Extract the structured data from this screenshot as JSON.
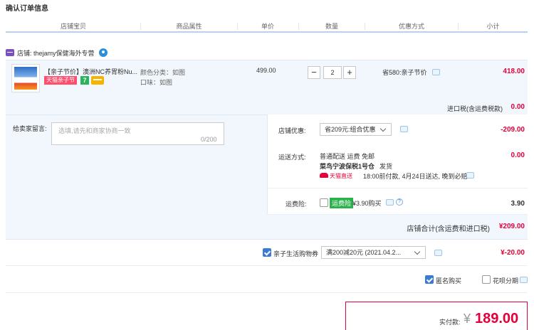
{
  "page_title": "确认订单信息",
  "columns": [
    "店铺宝贝",
    "商品属性",
    "单价",
    "数量",
    "优惠方式",
    "小计"
  ],
  "shop": {
    "label": "店铺: thejamy保健海外专营"
  },
  "item": {
    "title": "【亲子节价】澳洲NC养胃粉Nu...",
    "badge_tmall": "天猫亲子节",
    "badge_seven": "7",
    "attr_color": "颜色分类：如图",
    "attr_taste": "口味：如图",
    "price": "499.00",
    "qty_minus": "−",
    "qty_value": "2",
    "qty_plus": "+",
    "promo": "省580:亲子节价",
    "subtotal": "418.00"
  },
  "import_tax": {
    "label": "进口税(含运费税款)",
    "value": "0.00"
  },
  "note": {
    "label": "给卖家留言:",
    "placeholder": "选填,请先和商家协商一致",
    "count": "0/200"
  },
  "shop_discount": {
    "label": "店铺优惠:",
    "select": "省209元:组合优惠",
    "value": "-209.00"
  },
  "shipping": {
    "label": "运送方式:",
    "line1": "普通配送 运费 免邮",
    "line2_a": "菜鸟宁波保税1号仓",
    "line2_b": "发货",
    "direct_tag": "天猫直送",
    "line3": "18:00前付款, 4月24日送达, 晚到必赔",
    "value": "0.00"
  },
  "insurance": {
    "label": "运费险:",
    "tag": "运费险",
    "text": "¥3.90购买",
    "value": "3.90"
  },
  "shop_total": {
    "label": "店铺合计(含运费和进口税)",
    "value": "¥209.00"
  },
  "coupon": {
    "label": "亲子生活购物券",
    "select": "满200减20元 (2021.04.2...",
    "value": "¥-20.00"
  },
  "options": {
    "anonymous": "匿名购买",
    "huabei": "花呗分期"
  },
  "payment": {
    "label": "实付款:",
    "yen": "¥",
    "amount": "189.00"
  },
  "colors": {
    "accent_red": "#e4003a",
    "link_blue": "#3a7bd5",
    "panel_blue": "#f2f7fd"
  }
}
